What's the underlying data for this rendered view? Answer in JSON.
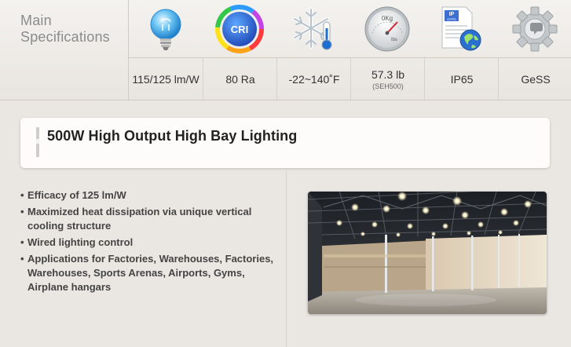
{
  "specs": {
    "title": "Main Specifications",
    "items": [
      {
        "icon": "lightbulb-icon",
        "value": "115/125 lm/W"
      },
      {
        "icon": "cri-icon",
        "icon_text": "CRI",
        "value": "80 Ra"
      },
      {
        "icon": "snowflake-thermometer-icon",
        "value": "-22~140˚F"
      },
      {
        "icon": "weight-scale-icon",
        "dial_top": "0Kg",
        "dial_bottom": "lbs",
        "value": "57.3 lb",
        "sub": "(SEH500)"
      },
      {
        "icon": "ip-level-document-icon",
        "doc_line1": "IP",
        "doc_line2": "LEVEL",
        "value": "IP65"
      },
      {
        "icon": "gear-icon",
        "value": "GeSS"
      }
    ]
  },
  "banner": {
    "title": "500W High Output High Bay Lighting"
  },
  "features": [
    "Efficacy of 125 lm/W",
    "Maximized heat dissipation via unique vertical cooling structure",
    "Wired lighting control",
    "Applications for Factories, Warehouses, Factories, Warehouses, Sports Arenas, Airports, Gyms, Airplane hangars"
  ],
  "photo": {
    "icon": "warehouse-interior-photo"
  },
  "colors": {
    "background": "#eae7e2",
    "text": "#333333",
    "muted": "#8b8b8b"
  }
}
